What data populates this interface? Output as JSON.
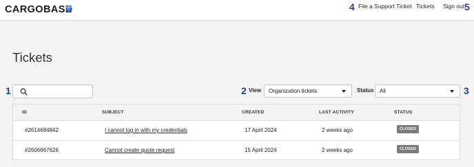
{
  "header": {
    "logo": "CARGOBASE",
    "nav": {
      "file_ticket": "File a Support Ticket",
      "tickets": "Tickets",
      "sign_out": "Sign out"
    }
  },
  "markers": [
    "1",
    "2",
    "3",
    "4",
    "5"
  ],
  "page_title": "Tickets",
  "search": {
    "value": "",
    "placeholder": ""
  },
  "filters": {
    "view_label": "View",
    "view_value": "Organization tickets",
    "status_label": "Status",
    "status_value": "All"
  },
  "table": {
    "columns": [
      "ID",
      "SUBJECT",
      "CREATED",
      "LAST ACTIVITY",
      "STATUS"
    ],
    "rows": [
      {
        "id": "#2614684842",
        "subject": "I cannot log in with my credentials",
        "created": "17 April 2024",
        "last_activity": "2 weeks ago",
        "status": "CLOSED"
      },
      {
        "id": "#2606667626",
        "subject": "Cannot create quote request",
        "created": "15 April 2024",
        "last_activity": "2 weeks ago",
        "status": "CLOSED"
      }
    ]
  },
  "colors": {
    "marker": "#1f3f95",
    "logo_cube": "#3a6fd0",
    "badge_closed": "#7b7b7b",
    "background": "#f3f3f4"
  },
  "icons": {
    "logo": "cube-icon",
    "search": "search-icon",
    "dropdown": "chevron-down-icon"
  }
}
